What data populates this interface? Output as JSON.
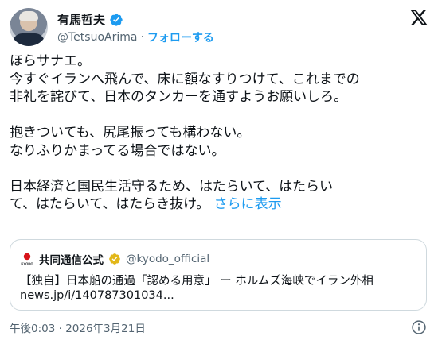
{
  "author": {
    "name": "有馬哲夫",
    "handle": "@TetsuoArima",
    "separator": "·",
    "follow_label": "フォローする",
    "verified": true
  },
  "post": {
    "text": "ほらサナエ。\n今すぐイランへ飛んで、床に額なすりつけて、これまでの\n非礼を詫びて、日本のタンカーを通すようお願いしろ。\n\n抱きついても、尻尾振っても構わない。\nなりふりかまってる場合ではない。\n\n日本経済と国民生活守るため、はたらいて、はたらい\nて、はたらいて、はたらき抜け。",
    "show_more_label": "さらに表示"
  },
  "quote": {
    "name": "共同通信公式",
    "handle": "@kyodo_official",
    "logo_text": "KYODO",
    "title": "【独自】日本船の通過「認める用意」 ー ホルムズ海峡でイラン外相",
    "link": "news.jp/i/140787301034..."
  },
  "timestamp": "午後0:03 · 2026年3月21日",
  "colors": {
    "accent": "#1d9bf0",
    "text": "#0f1419",
    "muted": "#536471",
    "border": "#cfd9de",
    "gold_badge": "#e2b719"
  },
  "icons": {
    "brand": "x-logo-icon",
    "verified": "verified-badge-icon",
    "info": "info-icon"
  }
}
